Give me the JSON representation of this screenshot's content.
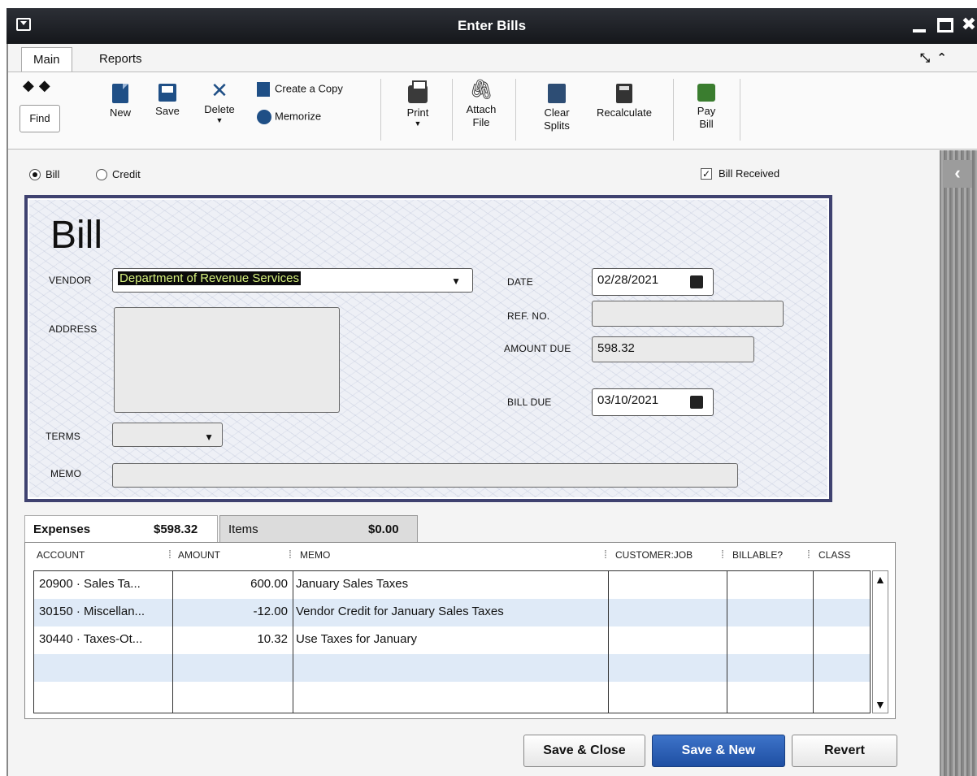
{
  "window": {
    "title": "Enter Bills"
  },
  "tabs": {
    "main": "Main",
    "reports": "Reports"
  },
  "toolbar": {
    "find": "Find",
    "new": "New",
    "save": "Save",
    "delete": "Delete",
    "create_copy": "Create a Copy",
    "memorize": "Memorize",
    "print": "Print",
    "attach_file_1": "Attach",
    "attach_file_2": "File",
    "clear_splits_1": "Clear",
    "clear_splits_2": "Splits",
    "recalculate": "Recalculate",
    "pay_bill_1": "Pay",
    "pay_bill_2": "Bill"
  },
  "form_type": {
    "bill": "Bill",
    "credit": "Credit",
    "selected": "Bill"
  },
  "bill_received": {
    "label": "Bill Received",
    "checked": true
  },
  "bill": {
    "heading": "Bill",
    "vendor_label": "VENDOR",
    "vendor": "Department of Revenue Services",
    "address_label": "ADDRESS",
    "address": "",
    "terms_label": "TERMS",
    "terms": "",
    "memo_label": "MEMO",
    "memo": "",
    "date_label": "DATE",
    "date": "02/28/2021",
    "ref_label": "REF. NO.",
    "ref": "",
    "amount_due_label": "AMOUNT DUE",
    "amount_due": "598.32",
    "bill_due_label": "BILL DUE",
    "bill_due": "03/10/2021"
  },
  "subtabs": {
    "expenses_label": "Expenses",
    "expenses_amount": "$598.32",
    "items_label": "Items",
    "items_amount": "$0.00"
  },
  "grid": {
    "headers": [
      "ACCOUNT",
      "AMOUNT",
      "MEMO",
      "CUSTOMER:JOB",
      "BILLABLE?",
      "CLASS"
    ],
    "rows": [
      {
        "account": "20900 · Sales Ta...",
        "amount": "600.00",
        "memo": "January Sales Taxes"
      },
      {
        "account": "30150 · Miscellan...",
        "amount": "-12.00",
        "memo": "Vendor Credit for January Sales Taxes"
      },
      {
        "account": "30440 · Taxes-Ot...",
        "amount": "10.32",
        "memo": "Use Taxes for January"
      }
    ]
  },
  "buttons": {
    "save_close": "Save & Close",
    "save_new": "Save & New",
    "revert": "Revert"
  }
}
